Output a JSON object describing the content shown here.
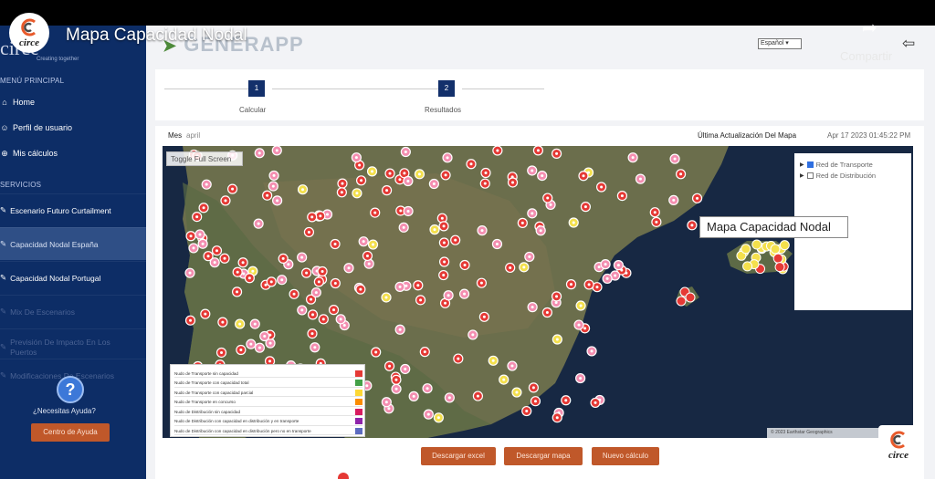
{
  "video": {
    "title": "Mapa Capacidad Nodal",
    "share_label": "Compartir",
    "share_icon": "share-icon",
    "channel_logo_text": "circe"
  },
  "app": {
    "logo_text": "GENERAPP",
    "brand_text": "circe",
    "brand_tagline": "Creating together",
    "language": "Español",
    "logout_icon": "logout-icon"
  },
  "sidebar": {
    "menu_heading": "MENÚ PRINCIPAL",
    "menu_items": [
      {
        "icon": "home-icon",
        "label": "Home"
      },
      {
        "icon": "user-icon",
        "label": "Perfil de usuario"
      },
      {
        "icon": "calc-icon",
        "label": "Mis cálculos"
      }
    ],
    "services_heading": "SERVICIOS",
    "service_items": [
      {
        "label": "Escenario Futuro Curtailment",
        "state": "normal"
      },
      {
        "label": "Capacidad Nodal España",
        "state": "active"
      },
      {
        "label": "Capacidad Nodal Portugal",
        "state": "normal"
      },
      {
        "label": "Mix De Escenarios",
        "state": "disabled"
      },
      {
        "label": "Previsión De Impacto En Los Puertos",
        "state": "disabled"
      },
      {
        "label": "Modificaciones De Escenarios",
        "state": "disabled"
      }
    ],
    "help_question": "¿Necesitas Ayuda?",
    "help_button": "Centro de Ayuda"
  },
  "stepper": {
    "steps": [
      {
        "number": "1",
        "label": "Calcular"
      },
      {
        "number": "2",
        "label": "Resultados"
      }
    ]
  },
  "results": {
    "month_label": "Mes",
    "month_value": "april",
    "update_label": "Última Actualización Del Mapa",
    "update_value": "Apr 17 2023 01:45:22 PM"
  },
  "map": {
    "toggle_label": "Toggle Full Screen",
    "tooltip": "Mapa Capacidad Nodal",
    "layers": [
      {
        "label": "Red de Transporte",
        "checked": true
      },
      {
        "label": "Red de Distribución",
        "checked": false
      }
    ],
    "legend": [
      {
        "label": "Nudo de Transporte sin capacidad",
        "color": "#e53935"
      },
      {
        "label": "Nudo de Transporte con capacidad total",
        "color": "#43a047"
      },
      {
        "label": "Nudo de Transporte con capacidad parcial",
        "color": "#fdd835"
      },
      {
        "label": "Nudo de Transporte en concurso",
        "color": "#fb8c00"
      },
      {
        "label": "Nudo de Distribución sin capacidad",
        "color": "#d81b60"
      },
      {
        "label": "Nudo de Distribución con capacidad en distribución y en transporte",
        "color": "#8e24aa"
      },
      {
        "label": "Nudo de Distribución con capacidad en distribución pero no en transporte",
        "color": "#5c6bc0"
      }
    ],
    "attribution": "© 2023 Earthstar Geographics",
    "marker_colors": {
      "red": "#e53935",
      "pink": "#f48fb1",
      "yellow": "#f4e04d"
    }
  },
  "actions": [
    {
      "label": "Descargar excel"
    },
    {
      "label": "Descargar mapa"
    },
    {
      "label": "Nuevo cálculo"
    }
  ]
}
